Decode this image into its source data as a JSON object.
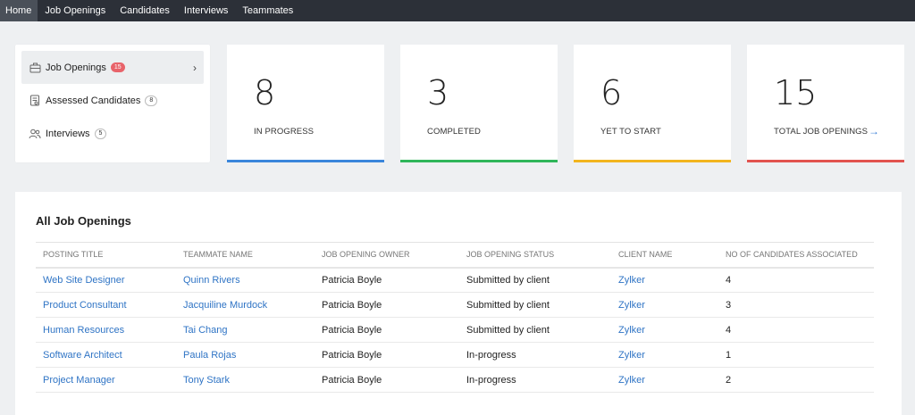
{
  "nav": [
    {
      "label": "Home",
      "active": true
    },
    {
      "label": "Job Openings"
    },
    {
      "label": "Candidates"
    },
    {
      "label": "Interviews"
    },
    {
      "label": "Teammates"
    }
  ],
  "summary": {
    "job_openings": {
      "label": "Job Openings",
      "count": "15"
    },
    "assessed": {
      "label": "Assessed Candidates",
      "count": "8"
    },
    "interviews": {
      "label": "Interviews",
      "count": "5"
    }
  },
  "cards": [
    {
      "value": "8",
      "label": "IN PROGRESS",
      "color": "#3a86db"
    },
    {
      "value": "3",
      "label": "COMPLETED",
      "color": "#2fb65a"
    },
    {
      "value": "6",
      "label": "YET TO START",
      "color": "#f2b51f"
    },
    {
      "value": "15",
      "label": "TOTAL JOB OPENINGS",
      "color": "#e2534f"
    }
  ],
  "table": {
    "title": "All Job Openings",
    "headers": [
      "POSTING TITLE",
      "TEAMMATE NAME",
      "JOB OPENING OWNER",
      "JOB OPENING STATUS",
      "CLIENT NAME",
      "NO OF CANDIDATES ASSOCIATED"
    ],
    "rows": [
      [
        "Web Site Designer",
        "Quinn Rivers",
        "Patricia Boyle",
        "Submitted by client",
        "Zylker",
        "4"
      ],
      [
        "Product Consultant",
        "Jacquiline Murdock",
        "Patricia Boyle",
        "Submitted by client",
        "Zylker",
        "3"
      ],
      [
        "Human Resources",
        "Tai Chang",
        "Patricia Boyle",
        "Submitted by client",
        "Zylker",
        "4"
      ],
      [
        "Software Architect",
        "Paula Rojas",
        "Patricia Boyle",
        "In-progress",
        "Zylker",
        "1"
      ],
      [
        "Project Manager",
        "Tony Stark",
        "Patricia Boyle",
        "In-progress",
        "Zylker",
        "2"
      ]
    ]
  }
}
